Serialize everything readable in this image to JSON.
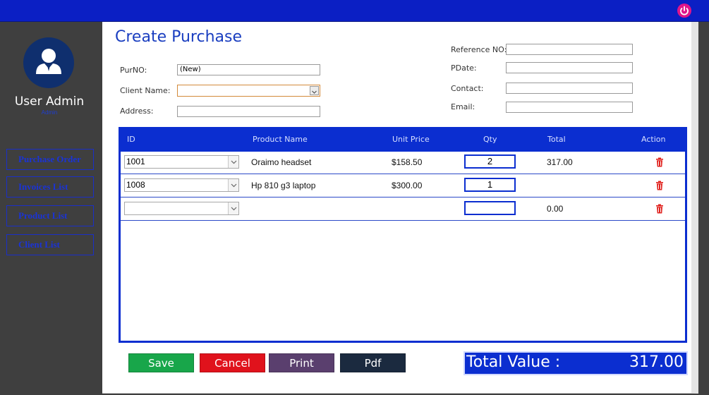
{
  "header": {
    "power_icon": "power-icon",
    "power_color": "#e0158a"
  },
  "sidebar": {
    "user_name": "User Admin",
    "user_role": "Admin",
    "items": [
      {
        "label": "Purchase Order"
      },
      {
        "label": "Invoices List"
      },
      {
        "label": "Product List"
      },
      {
        "label": "Client List"
      }
    ]
  },
  "form": {
    "title": "Create Purchase",
    "purno_label": "PurNO:",
    "purno_value": "(New)",
    "client_label": "Client Name:",
    "client_value": "",
    "address_label": "Address:",
    "address_value": "",
    "reference_label": "Reference NO:",
    "reference_value": "",
    "pdate_label": "PDate:",
    "pdate_value": "",
    "contact_label": "Contact:",
    "contact_value": "",
    "email_label": "Email:",
    "email_value": ""
  },
  "grid": {
    "columns": [
      "ID",
      "Product Name",
      "Unit Price",
      "Qty",
      "Total",
      "Action"
    ],
    "rows": [
      {
        "id": "1001",
        "product": "Oraimo headset",
        "price": "$158.50",
        "qty": "2",
        "total": "317.00"
      },
      {
        "id": "1008",
        "product": "Hp 810 g3 laptop",
        "price": "$300.00",
        "qty": "1",
        "total": ""
      },
      {
        "id": "",
        "product": "",
        "price": "",
        "qty": "",
        "total": "0.00"
      }
    ]
  },
  "actions": {
    "save_label": "Save",
    "cancel_label": "Cancel",
    "print_label": "Print",
    "pdf_label": "Pdf"
  },
  "summary": {
    "total_label": "Total Value :",
    "total_value": "317.00"
  },
  "colors": {
    "accent": "#0b2ed0",
    "save": "#18a64a",
    "cancel": "#e0121c",
    "print": "#5a3f6e",
    "pdf": "#1b2a3f"
  }
}
